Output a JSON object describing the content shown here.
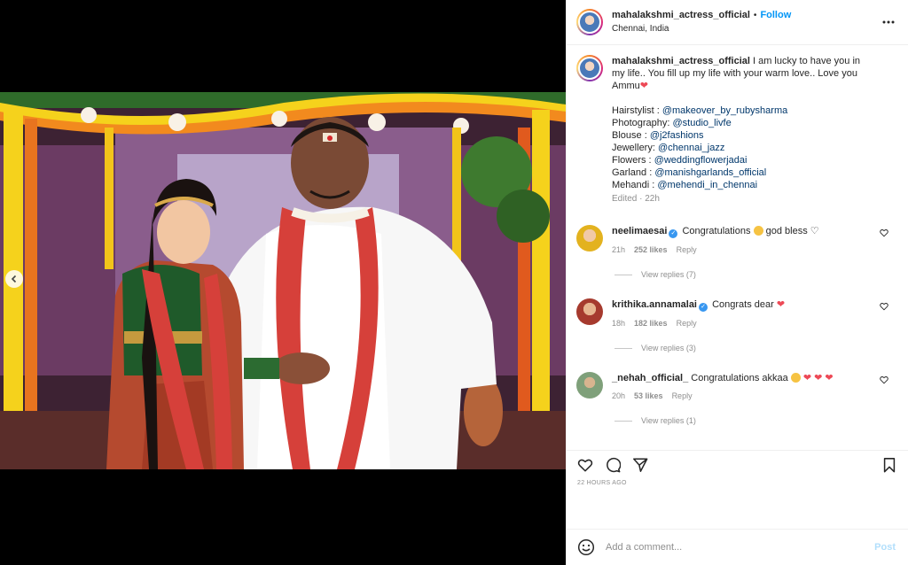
{
  "post": {
    "username": "mahalakshmi_actress_official",
    "separator": "•",
    "follow_label": "Follow",
    "location": "Chennai, India"
  },
  "caption": {
    "username": "mahalakshmi_actress_official",
    "text": " I am lucky to have you in my life.. You fill up my life with your warm love.. Love you Ammu",
    "heart": "❤",
    "credits": [
      {
        "label": "Hairstylist : ",
        "mention": "@makeover_by_rubysharma"
      },
      {
        "label": "Photography: ",
        "mention": "@studio_livfe"
      },
      {
        "label": "Blouse : ",
        "mention": "@j2fashions"
      },
      {
        "label": "Jewellery: ",
        "mention": "@chennai_jazz"
      },
      {
        "label": "Flowers : ",
        "mention": "@weddingflowerjadai"
      },
      {
        "label": "Garland : ",
        "mention": "@manishgarlands_official"
      },
      {
        "label": "Mehandi : ",
        "mention": "@mehendi_in_chennai"
      }
    ],
    "edited": "Edited · 22h"
  },
  "comments": [
    {
      "username": "neelimaesai",
      "verified": true,
      "text": "Congratulations",
      "text2": "god bless ♡",
      "time": "21h",
      "likes": "252 likes",
      "reply": "Reply",
      "view_replies": "View replies (7)"
    },
    {
      "username": "krithika.annamalai",
      "verified": true,
      "text": "Congrats dear",
      "text2": "❤",
      "time": "18h",
      "likes": "182 likes",
      "reply": "Reply",
      "view_replies": "View replies (3)"
    },
    {
      "username": "_nehah_official_",
      "verified": false,
      "text": "Congratulations akkaa",
      "text2": "❤ ❤ ❤",
      "time": "20h",
      "likes": "53 likes",
      "reply": "Reply",
      "view_replies": "View replies (1)"
    }
  ],
  "footer": {
    "time_ago": "22 HOURS AGO",
    "comment_placeholder": "Add a comment...",
    "post_label": "Post"
  },
  "icons": {
    "like": "heart-icon",
    "comment": "comment-icon",
    "share": "share-icon",
    "save": "bookmark-icon",
    "more": "more-options-icon",
    "emoji": "smiley-icon",
    "prev": "chevron-left-icon"
  },
  "colors": {
    "follow": "#0095f6",
    "mention": "#00376b",
    "muted": "#8e8e8e",
    "heart": "#ed4956"
  }
}
